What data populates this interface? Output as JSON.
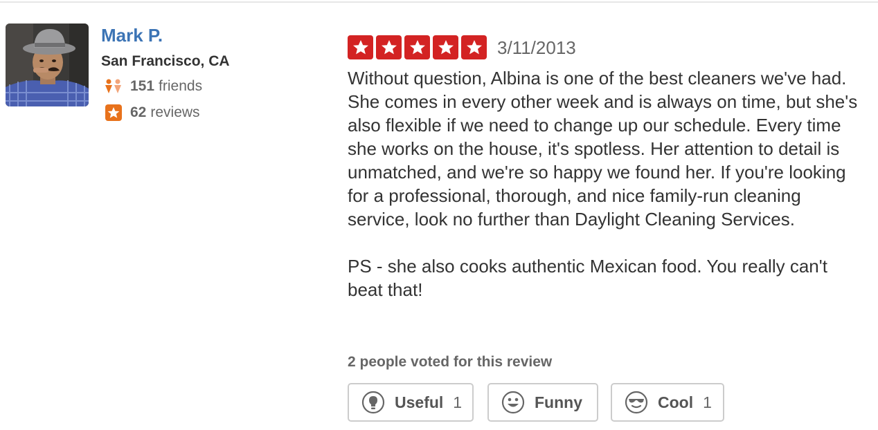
{
  "reviewer": {
    "name": "Mark P.",
    "location": "San Francisco, CA",
    "friends_count": "151",
    "friends_label": "friends",
    "reviews_count": "62",
    "reviews_label": "reviews",
    "avatar_icon": "user-photo"
  },
  "review": {
    "rating": 5,
    "max_rating": 5,
    "star_color": "#d32323",
    "date": "3/11/2013",
    "paragraphs": [
      "Without question, Albina is one of the best cleaners we've had.  She comes in every other week and is always on time, but she's also flexible if we need to change up our schedule.  Every time she works on the house, it's spotless.  Her attention to detail is unmatched, and we're so happy we found her.  If you're looking for a professional, thorough, and nice family-run cleaning service, look no further than Daylight Cleaning Services.",
      "PS - she also cooks authentic Mexican food.  You really can't beat that!"
    ]
  },
  "votes": {
    "summary": "2 people voted for this review",
    "useful_label": "Useful",
    "useful_count": "1",
    "funny_label": "Funny",
    "funny_count": "",
    "cool_label": "Cool",
    "cool_count": "1"
  },
  "colors": {
    "link": "#3c74b5",
    "accent_orange": "#e8721c",
    "friends_icon_dark": "#e8721c",
    "friends_icon_light": "#f2a479"
  }
}
